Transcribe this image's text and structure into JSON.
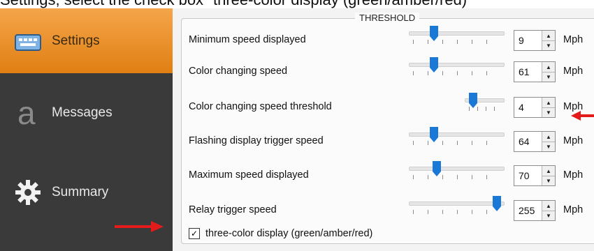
{
  "instruction": "Settings, select the check box \"three-color display (green/amber/red)\"",
  "sidebar": {
    "items": [
      {
        "label": "Settings",
        "icon": "keyboard-icon",
        "active": true
      },
      {
        "label": "Messages",
        "icon": "letter-a-icon",
        "active": false
      },
      {
        "label": "Summary",
        "icon": "gear-icon",
        "active": false
      }
    ],
    "active_color": "#f29a2e"
  },
  "threshold": {
    "title": "THRESHOLD",
    "rows": [
      {
        "label": "Minimum speed displayed",
        "value": "9",
        "unit": "Mph"
      },
      {
        "label": "Color changing speed",
        "value": "61",
        "unit": "Mph"
      },
      {
        "label": "Color changing speed threshold",
        "value": "4",
        "unit": "Mph"
      },
      {
        "label": "Flashing display trigger speed",
        "value": "64",
        "unit": "Mph"
      },
      {
        "label": "Maximum speed displayed",
        "value": "70",
        "unit": "Mph"
      },
      {
        "label": "Relay trigger speed",
        "value": "255",
        "unit": "Mph"
      }
    ],
    "checkbox": {
      "label": "three-color display (green/amber/red)",
      "checked": true
    }
  },
  "accent_colors": {
    "slider_thumb": "#1a78d6",
    "annotation_arrow": "#e31b1b"
  }
}
